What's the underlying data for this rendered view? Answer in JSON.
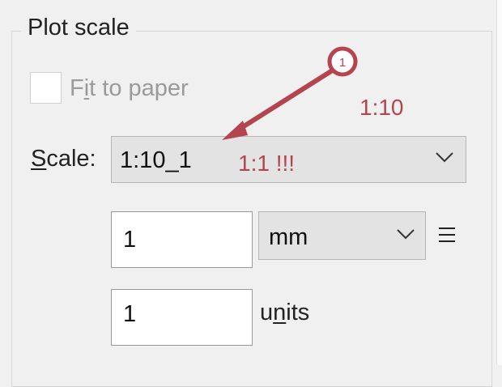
{
  "plot_scale": {
    "title": "Plot scale",
    "fit_to_paper": {
      "label": "Fit to paper",
      "checked": false,
      "enabled": false
    },
    "scale": {
      "label": "Scale:",
      "selected": "1:10_1"
    },
    "paper_value": "1",
    "paper_unit": "mm",
    "drawing_value": "1",
    "drawing_unit_label": "units"
  },
  "annotation": {
    "marker": "1",
    "note_1": "1:10",
    "note_2": "1:1 !!!",
    "color": "#b4454f"
  },
  "icons": {
    "dropdown": "chevron-down-icon",
    "equals": "equals-icon",
    "checkbox": "checkbox-icon"
  }
}
